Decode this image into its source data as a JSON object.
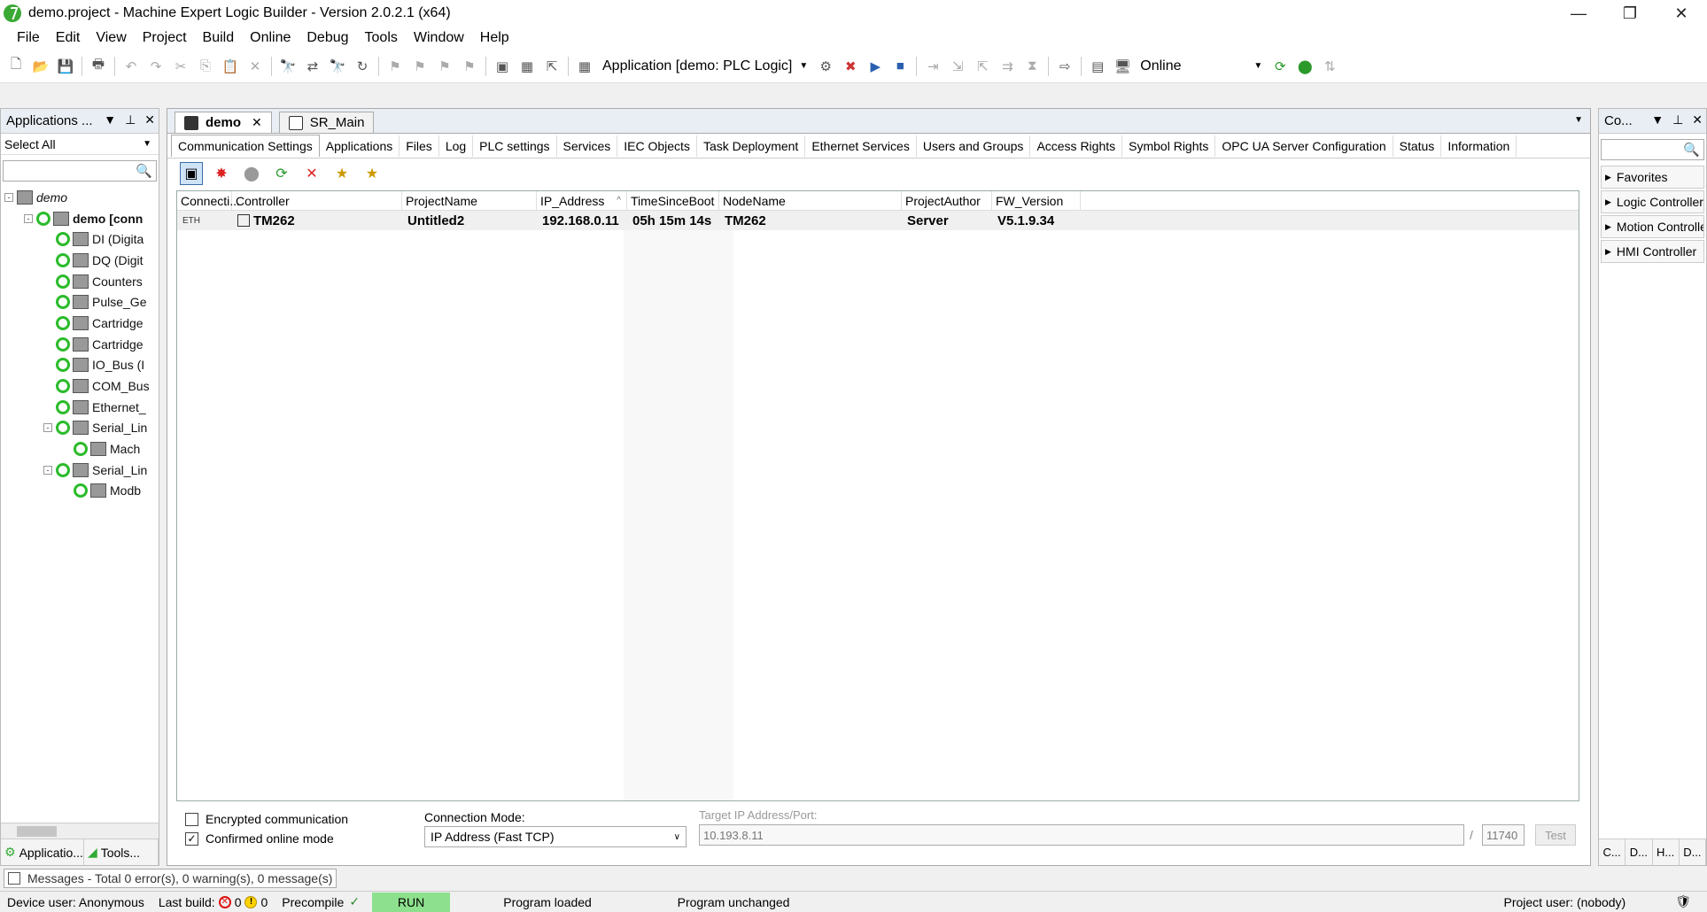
{
  "window": {
    "title": "demo.project - Machine Expert Logic Builder - Version 2.0.2.1 (x64)",
    "minimize": "—",
    "restore": "❐",
    "close": "✕"
  },
  "menu": [
    "File",
    "Edit",
    "View",
    "Project",
    "Build",
    "Online",
    "Debug",
    "Tools",
    "Window",
    "Help"
  ],
  "toolbar": {
    "application_combo": "Application [demo: PLC Logic]",
    "mode_combo": "Online"
  },
  "left_panel": {
    "title": "Applications ...",
    "filter": "Select All",
    "tree": [
      {
        "label": "demo",
        "level": 0,
        "style": "italic",
        "expander": "-"
      },
      {
        "label": "demo [conn",
        "level": 1,
        "style": "bold",
        "expander": "-"
      },
      {
        "label": "DI (Digita",
        "level": 2
      },
      {
        "label": "DQ (Digit",
        "level": 2
      },
      {
        "label": "Counters",
        "level": 2
      },
      {
        "label": "Pulse_Ge",
        "level": 2
      },
      {
        "label": "Cartridge",
        "level": 2
      },
      {
        "label": "Cartridge",
        "level": 2
      },
      {
        "label": "IO_Bus (I",
        "level": 2
      },
      {
        "label": "COM_Bus",
        "level": 2
      },
      {
        "label": "Ethernet_",
        "level": 2
      },
      {
        "label": "Serial_Lin",
        "level": 2,
        "expander": "-"
      },
      {
        "label": "Mach",
        "level": 3
      },
      {
        "label": "Serial_Lin",
        "level": 2,
        "expander": "-"
      },
      {
        "label": "Modb",
        "level": 3
      }
    ],
    "tabs": [
      "Applicatio...",
      "Tools..."
    ]
  },
  "editor": {
    "doc_tabs": [
      {
        "label": "demo",
        "active": true
      },
      {
        "label": "SR_Main",
        "active": false
      }
    ],
    "sub_tabs": [
      "Communication Settings",
      "Applications",
      "Files",
      "Log",
      "PLC settings",
      "Services",
      "IEC Objects",
      "Task Deployment",
      "Ethernet Services",
      "Users and Groups",
      "Access Rights",
      "Symbol Rights",
      "OPC UA Server Configuration",
      "Status",
      "Information"
    ],
    "grid": {
      "columns": [
        "Connecti...",
        "Controller",
        "ProjectName",
        "IP_Address",
        "TimeSinceBoot",
        "NodeName",
        "ProjectAuthor",
        "FW_Version"
      ],
      "rows": [
        {
          "connection": "ETH",
          "controller": "TM262",
          "project_name": "Untitled2",
          "ip_address": "192.168.0.11",
          "time_since_boot": "05h 15m 14s",
          "node_name": "TM262",
          "project_author": "Server",
          "fw_version": "V5.1.9.34"
        }
      ]
    },
    "options": {
      "encrypted_label": "Encrypted communication",
      "confirmed_label": "Confirmed online mode",
      "connection_mode_label": "Connection Mode:",
      "connection_mode_value": "IP Address (Fast TCP)",
      "target_label": "Target IP Address/Port:",
      "target_ip": "10.193.8.11",
      "port_separator": "/",
      "target_port": "11740",
      "test_label": "Test"
    }
  },
  "right_panel": {
    "title": "Co...",
    "items": [
      "Favorites",
      "Logic Controller",
      "Motion Controller",
      "HMI Controller"
    ],
    "tabs": [
      "C...",
      "D...",
      "H...",
      "D..."
    ]
  },
  "messages": "Messages - Total 0 error(s), 0 warning(s), 0 message(s)",
  "status": {
    "device_user": "Device user: Anonymous",
    "last_build": "Last build:",
    "errors": "0",
    "warnings": "0",
    "precompile": "Precompile",
    "run": "RUN",
    "program_loaded": "Program loaded",
    "program_unchanged": "Program unchanged",
    "project_user": "Project user: (nobody)"
  }
}
